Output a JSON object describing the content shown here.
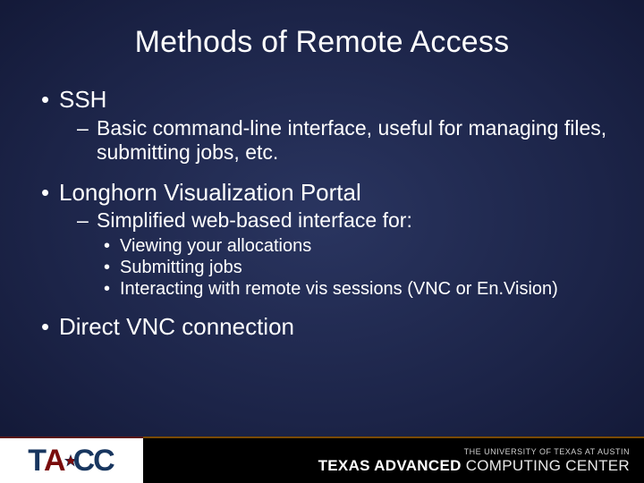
{
  "title": "Methods of Remote Access",
  "bullets": {
    "b1": "SSH",
    "b1_1": "Basic command-line interface, useful for managing files, submitting jobs, etc.",
    "b2": "Longhorn Visualization Portal",
    "b2_1": "Simplified web-based interface for:",
    "b2_1_1": "Viewing your allocations",
    "b2_1_2": "Submitting jobs",
    "b2_1_3": "Interacting with remote vis sessions (VNC or En.Vision)",
    "b3": "Direct VNC connection"
  },
  "footer": {
    "ut": "THE UNIVERSITY OF TEXAS AT AUSTIN",
    "tacc_bold": "TEXAS ADVANCED",
    "tacc_light": " COMPUTING CENTER",
    "logo_t": "T",
    "logo_a": "A",
    "logo_c1": "C",
    "logo_c2": "C"
  }
}
